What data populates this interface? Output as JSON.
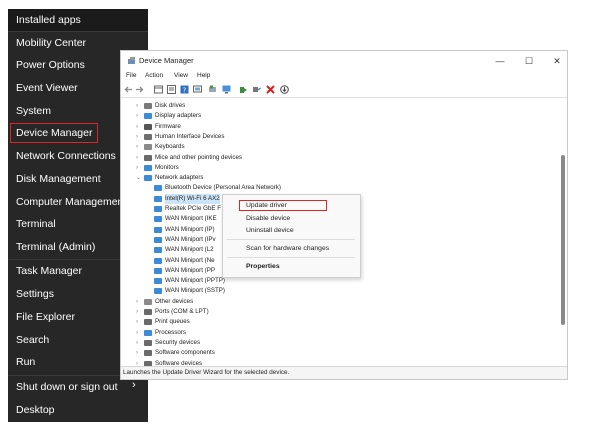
{
  "winx_menu": {
    "items": [
      {
        "label": "Installed apps"
      },
      {
        "label": "Mobility Center"
      },
      {
        "label": "Power Options"
      },
      {
        "label": "Event Viewer"
      },
      {
        "label": "System"
      },
      {
        "label": "Device Manager"
      },
      {
        "label": "Network Connections"
      },
      {
        "label": "Disk Management"
      },
      {
        "label": "Computer Management"
      },
      {
        "label": "Terminal"
      },
      {
        "label": "Terminal (Admin)"
      },
      {
        "label": "Task Manager"
      },
      {
        "label": "Settings"
      },
      {
        "label": "File Explorer"
      },
      {
        "label": "Search"
      },
      {
        "label": "Run"
      },
      {
        "label": "Shut down or sign out"
      },
      {
        "label": "Desktop"
      }
    ],
    "submenu_arrow": "›"
  },
  "device_manager": {
    "title": "Device Manager",
    "window_buttons": {
      "minimize": "—",
      "maximize": "☐",
      "close": "✕"
    },
    "menu": [
      "File",
      "Action",
      "View",
      "Help"
    ],
    "tree": [
      {
        "label": "Disk drives",
        "chev": "›",
        "icon_color": "#7a7a7a"
      },
      {
        "label": "Display adapters",
        "chev": "›",
        "icon_color": "#3b8bd9"
      },
      {
        "label": "Firmware",
        "chev": "›",
        "icon_color": "#555555"
      },
      {
        "label": "Human Interface Devices",
        "chev": "›",
        "icon_color": "#6f6f6f"
      },
      {
        "label": "Keyboards",
        "chev": "›",
        "icon_color": "#8a8a8a"
      },
      {
        "label": "Mice and other pointing devices",
        "chev": "›",
        "icon_color": "#6a6a6a"
      },
      {
        "label": "Monitors",
        "chev": "›",
        "icon_color": "#3b8bd9"
      },
      {
        "label": "Network adapters",
        "chev": "⌄",
        "icon_color": "#3b8bd9"
      },
      {
        "label": "Bluetooth Device (Personal Area Network)",
        "chev": "",
        "icon_color": "#3b8bd9"
      },
      {
        "label": "Intel(R) Wi-Fi 6 AX2",
        "chev": "",
        "icon_color": "#3b8bd9"
      },
      {
        "label": "Realtek PCIe GbE F",
        "chev": "",
        "icon_color": "#3b8bd9"
      },
      {
        "label": "WAN Miniport (IKE",
        "chev": "",
        "icon_color": "#3b8bd9"
      },
      {
        "label": "WAN Miniport (IP)",
        "chev": "",
        "icon_color": "#3b8bd9"
      },
      {
        "label": "WAN Miniport (IPv",
        "chev": "",
        "icon_color": "#3b8bd9"
      },
      {
        "label": "WAN Miniport (L2",
        "chev": "",
        "icon_color": "#3b8bd9"
      },
      {
        "label": "WAN Miniport (Ne",
        "chev": "",
        "icon_color": "#3b8bd9"
      },
      {
        "label": "WAN Miniport (PP",
        "chev": "",
        "icon_color": "#3b8bd9"
      },
      {
        "label": "WAN Miniport (PPTP)",
        "chev": "",
        "icon_color": "#3b8bd9"
      },
      {
        "label": "WAN Miniport (SSTP)",
        "chev": "",
        "icon_color": "#3b8bd9"
      },
      {
        "label": "Other devices",
        "chev": "›",
        "icon_color": "#8a8a8a"
      },
      {
        "label": "Ports (COM & LPT)",
        "chev": "›",
        "icon_color": "#6a6a6a"
      },
      {
        "label": "Print queues",
        "chev": "›",
        "icon_color": "#6a6a6a"
      },
      {
        "label": "Processors",
        "chev": "›",
        "icon_color": "#3b8bd9"
      },
      {
        "label": "Security devices",
        "chev": "›",
        "icon_color": "#6a6a6a"
      },
      {
        "label": "Software components",
        "chev": "›",
        "icon_color": "#6a6a6a"
      },
      {
        "label": "Software devices",
        "chev": "›",
        "icon_color": "#6a6a6a"
      }
    ],
    "status": "Launches the Update Driver Wizard for the selected device."
  },
  "context_menu": {
    "items": [
      {
        "label": "Update driver"
      },
      {
        "label": "Disable device"
      },
      {
        "label": "Uninstall device"
      },
      {
        "label": "Scan for hardware changes"
      },
      {
        "label": "Properties"
      }
    ]
  },
  "colors": {
    "highlight": "#d62828",
    "menu_bg": "#272727",
    "selection": "#cce4f7"
  }
}
